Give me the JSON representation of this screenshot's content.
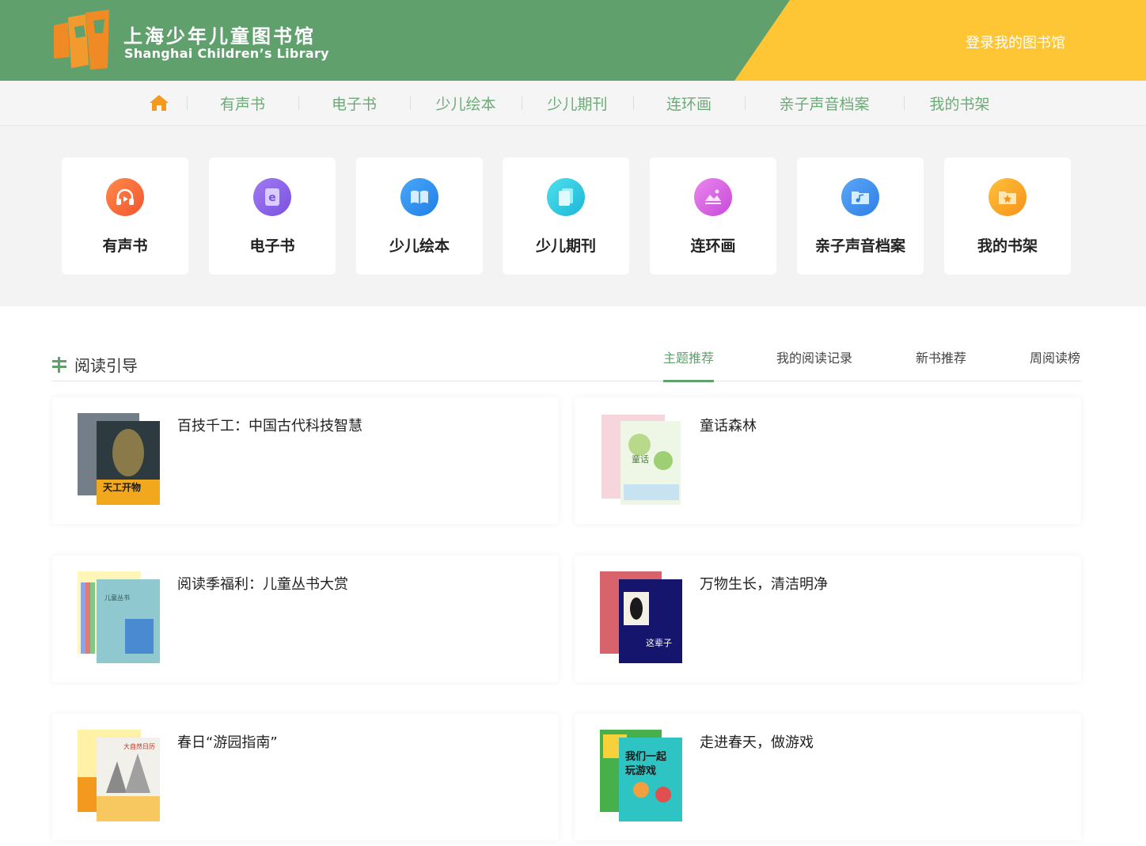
{
  "header": {
    "brand_cn": "上海少年儿童图书馆",
    "brand_en": "Shanghai Children’s Library",
    "login_label": "登录我的图书馆",
    "colors": {
      "green": "#5fa06c",
      "yellow": "#fec535",
      "logo_orange": "#f08a24"
    }
  },
  "nav": {
    "home_icon": "home-icon",
    "items": [
      {
        "label": "有声书"
      },
      {
        "label": "电子书"
      },
      {
        "label": "少儿绘本"
      },
      {
        "label": "少儿期刊"
      },
      {
        "label": "连环画"
      },
      {
        "label": "亲子声音档案"
      },
      {
        "label": "我的书架"
      }
    ]
  },
  "categories": [
    {
      "label": "有声书",
      "icon": "headphones-icon",
      "color": "#f46a3b"
    },
    {
      "label": "电子书",
      "icon": "ebook-icon",
      "color": "#8a63e6"
    },
    {
      "label": "少儿绘本",
      "icon": "open-book-icon",
      "color": "#2e8ff0"
    },
    {
      "label": "少儿期刊",
      "icon": "journal-icon",
      "color": "#2fc6e0"
    },
    {
      "label": "连环画",
      "icon": "picture-icon",
      "color": "#d862e0"
    },
    {
      "label": "亲子声音档案",
      "icon": "audio-folder-icon",
      "color": "#3b8ff0"
    },
    {
      "label": "我的书架",
      "icon": "star-folder-icon",
      "color": "#f7a21b"
    }
  ],
  "guide": {
    "title": "阅读引导",
    "tabs": [
      {
        "label": "主题推荐",
        "active": true
      },
      {
        "label": "我的阅读记录",
        "active": false
      },
      {
        "label": "新书推荐",
        "active": false
      },
      {
        "label": "周阅读榜",
        "active": false
      }
    ],
    "items": [
      {
        "title": "百技千工：中国古代科技智慧",
        "cover": "tiangong-kaiwu-cover"
      },
      {
        "title": "童话森林",
        "cover": "fairy-tale-cover"
      },
      {
        "title": "阅读季福利：儿童丛书大赏",
        "cover": "book-series-cover"
      },
      {
        "title": "万物生长，清洁明净",
        "cover": "leaf-book-cover"
      },
      {
        "title": "春日“游园指南”",
        "cover": "nature-calendar-cover"
      },
      {
        "title": "走进春天，做游戏",
        "cover": "games-book-cover"
      }
    ]
  }
}
